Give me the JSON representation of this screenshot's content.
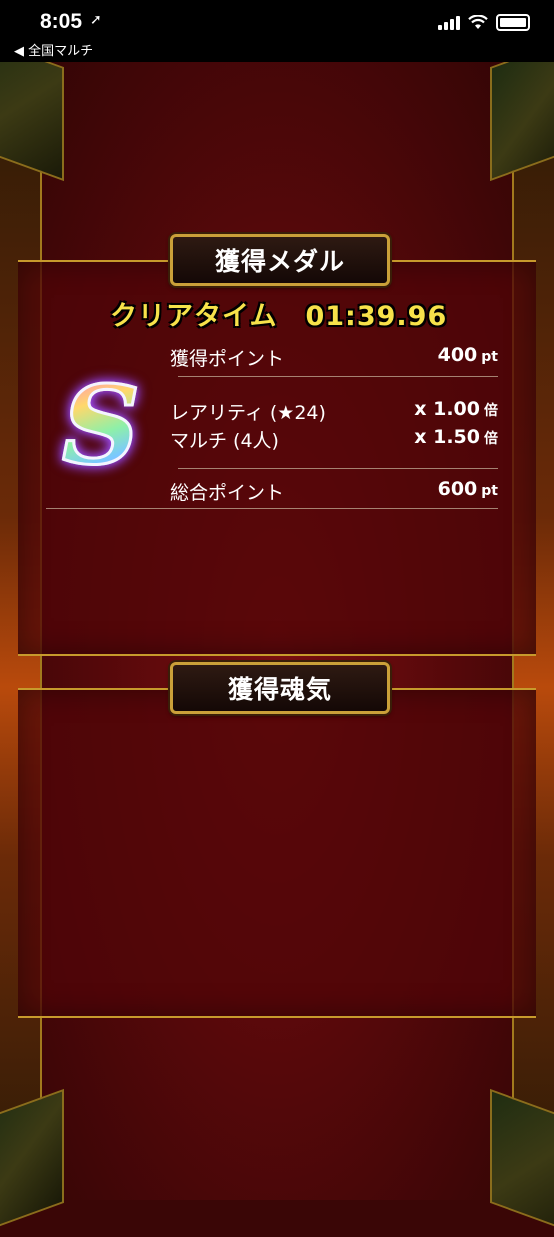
{
  "status_bar": {
    "time": "8:05",
    "location_arrow": "➚",
    "back_label": "◀ 全国マルチ"
  },
  "medal_panel": {
    "title": "獲得メダル",
    "clear_time_label": "クリアタイム",
    "clear_time_value": "01:39.96",
    "rank": "S",
    "points_label": "獲得ポイント",
    "points_value": "400",
    "points_unit": "pt",
    "rarity_label": "レアリティ (★24)",
    "rarity_value": "x 1.00",
    "rarity_unit": "倍",
    "multi_label": "マルチ (4人)",
    "multi_value": "x 1.50",
    "multi_unit": "倍",
    "total_label": "総合ポイント",
    "total_value": "600",
    "total_unit": "pt"
  },
  "soul_panel": {
    "title": "獲得魂気"
  }
}
